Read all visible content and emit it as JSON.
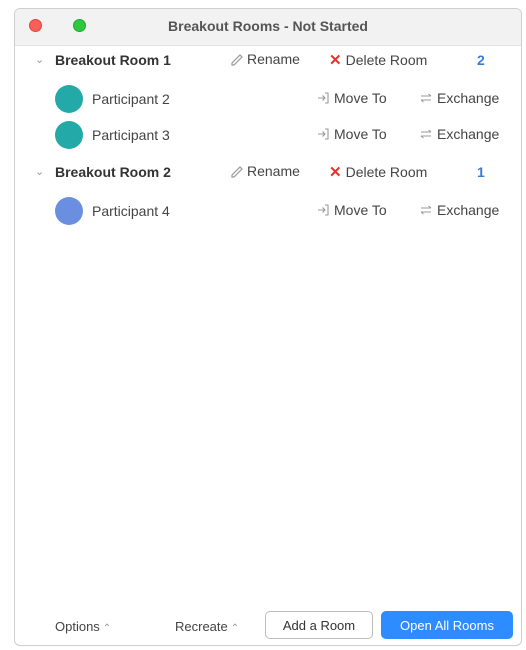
{
  "window": {
    "title": "Breakout Rooms - Not Started"
  },
  "actions": {
    "rename": "Rename",
    "delete_room": "Delete Room",
    "move_to": "Move To",
    "exchange": "Exchange"
  },
  "rooms": [
    {
      "name": "Breakout Room 1",
      "count": "2",
      "participants": [
        {
          "name": "Participant 2",
          "avatar_color": "#23aaa8"
        },
        {
          "name": "Participant 3",
          "avatar_color": "#23aaa8"
        }
      ]
    },
    {
      "name": "Breakout Room 2",
      "count": "1",
      "participants": [
        {
          "name": "Participant 4",
          "avatar_color": "#6b8fe0"
        }
      ]
    }
  ],
  "footer": {
    "options": "Options",
    "recreate": "Recreate",
    "add_room": "Add a Room",
    "open_all_rooms": "Open All Rooms"
  },
  "colors": {
    "accent": "#2d8cff",
    "count": "#3a7bd5",
    "delete_x": "#e0342c"
  },
  "icons": {
    "close": "close-window-button",
    "zoom": "zoom-window-button",
    "collapse": "chevron-down-icon",
    "rename": "pencil-icon",
    "delete": "x-icon",
    "move": "move-to-icon",
    "exchange": "exchange-icon",
    "footer_caret": "caret-up-icon"
  }
}
